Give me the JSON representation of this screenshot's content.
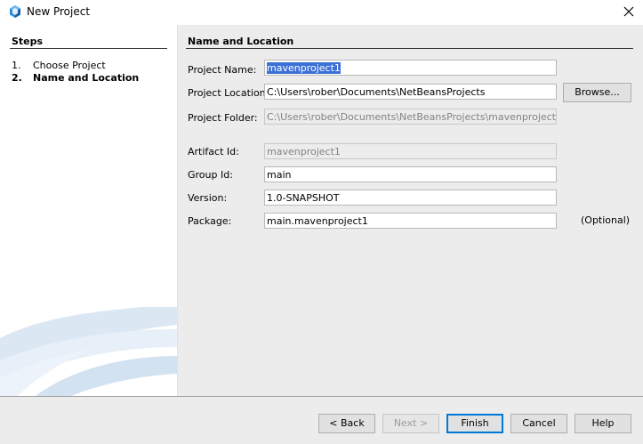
{
  "window": {
    "title": "New Project",
    "close_icon": "close-icon"
  },
  "steps": {
    "header": "Steps",
    "items": [
      {
        "num": "1.",
        "label": "Choose Project"
      },
      {
        "num": "2.",
        "label": "Name and Location"
      }
    ]
  },
  "panel": {
    "header": "Name and Location",
    "fields": {
      "project_name": {
        "label": "Project Name:",
        "value": "mavenproject1"
      },
      "project_location": {
        "label": "Project Location:",
        "value": "C:\\Users\\rober\\Documents\\NetBeansProjects"
      },
      "project_folder": {
        "label": "Project Folder:",
        "value": "C:\\Users\\rober\\Documents\\NetBeansProjects\\mavenproject1"
      },
      "artifact_id": {
        "label": "Artifact Id:",
        "value": "mavenproject1"
      },
      "group_id": {
        "label": "Group Id:",
        "value": "main"
      },
      "version": {
        "label": "Version:",
        "value": "1.0-SNAPSHOT"
      },
      "package": {
        "label": "Package:",
        "value": "main.mavenproject1",
        "hint": "(Optional)"
      }
    },
    "browse_label": "Browse..."
  },
  "buttons": {
    "back": "< Back",
    "next": "Next >",
    "finish": "Finish",
    "cancel": "Cancel",
    "help": "Help"
  },
  "colors": {
    "selection": "#3b70d6",
    "default_button_border": "#0078d7"
  }
}
